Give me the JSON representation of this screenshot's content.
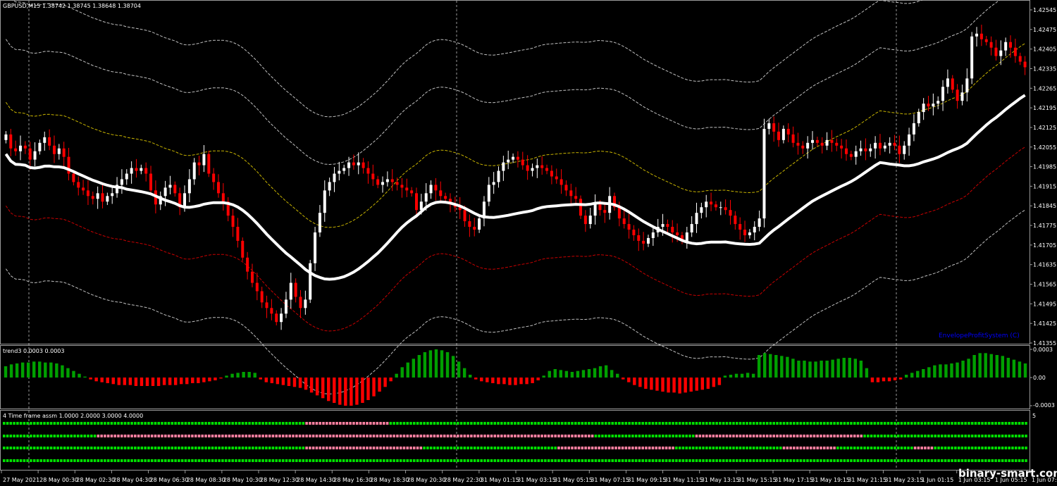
{
  "colors": {
    "background": "#000000",
    "bull_candle": "#ffffff",
    "bear_candle": "#ff0000",
    "ma_line": "#ffffff",
    "upper_env_1": "#c8b400",
    "lower_env_1": "#c80000",
    "outer_env": "#c0c0c0",
    "hist_up": "#00a000",
    "hist_down": "#ff0000",
    "dot_green": "#00e000",
    "dot_pink": "#ff7fa0",
    "signature": "#0000ff",
    "separator": "#9a9a9a",
    "grid_v": "#c0c0c0"
  },
  "main_header": {
    "symbol": "GBPUSD,M15",
    "ohlc": "1.38742 1.38745 1.38648 1.38704"
  },
  "main_signature": "EnvelopeProfitSystem (C)",
  "trend_header": "trend3 0.0003 0.0003",
  "tf_header": "4 Time frame assm 1.0000 2.0000 3.0000 4.0000",
  "tf_right_label": "5",
  "watermark": "binary-smart.com",
  "chart_data": [
    {
      "type": "candlestick",
      "title": "GBPUSD,M15",
      "y_ticks": [
        "1.42545",
        "1.42475",
        "1.42405",
        "1.42335",
        "1.42265",
        "1.42195",
        "1.42125",
        "1.42055",
        "1.41985",
        "1.41915",
        "1.41845",
        "1.41775",
        "1.41705",
        "1.41635",
        "1.41565",
        "1.41495",
        "1.41425",
        "1.41355"
      ],
      "ylim": [
        1.41355,
        1.42545
      ],
      "x_ticks": [
        "27 May 2021",
        "28 May 00:30",
        "28 May 02:30",
        "28 May 04:30",
        "28 May 06:30",
        "28 May 08:30",
        "28 May 10:30",
        "28 May 12:30",
        "28 May 14:30",
        "28 May 16:30",
        "28 May 18:30",
        "28 May 20:30",
        "28 May 22:30",
        "31 May 01:15",
        "31 May 03:15",
        "31 May 05:15",
        "31 May 07:15",
        "31 May 09:15",
        "31 May 11:15",
        "31 May 13:15",
        "31 May 15:15",
        "31 May 17:15",
        "31 May 19:15",
        "31 May 21:15",
        "31 May 23:15",
        "1 Jun 01:15",
        "1 Jun 03:15",
        "1 Jun 05:15",
        "1 Jun 07:15"
      ],
      "closes": [
        1.421,
        1.4205,
        1.4204,
        1.4206,
        1.4205,
        1.4201,
        1.4204,
        1.4207,
        1.4209,
        1.4206,
        1.4203,
        1.4205,
        1.4202,
        1.4196,
        1.4193,
        1.4191,
        1.419,
        1.4188,
        1.4187,
        1.4189,
        1.4186,
        1.4188,
        1.4189,
        1.4192,
        1.4194,
        1.4196,
        1.4198,
        1.4197,
        1.4198,
        1.4196,
        1.419,
        1.4185,
        1.4188,
        1.4191,
        1.4192,
        1.4189,
        1.4184,
        1.4189,
        1.4194,
        1.42,
        1.4199,
        1.4203,
        1.4196,
        1.4193,
        1.4189,
        1.4186,
        1.4181,
        1.4177,
        1.4172,
        1.4166,
        1.4161,
        1.4157,
        1.4154,
        1.415,
        1.4148,
        1.4146,
        1.4143,
        1.4146,
        1.4151,
        1.4157,
        1.4152,
        1.4148,
        1.4151,
        1.4164,
        1.4175,
        1.4182,
        1.419,
        1.4193,
        1.4196,
        1.4197,
        1.4198,
        1.42,
        1.4199,
        1.42,
        1.4198,
        1.4196,
        1.4194,
        1.4192,
        1.4193,
        1.4194,
        1.4193,
        1.4192,
        1.4191,
        1.419,
        1.4189,
        1.4183,
        1.4186,
        1.4189,
        1.4192,
        1.419,
        1.4188,
        1.4187,
        1.4185,
        1.4184,
        1.4183,
        1.4179,
        1.4177,
        1.4176,
        1.418,
        1.4186,
        1.4192,
        1.4193,
        1.4197,
        1.42,
        1.4201,
        1.4202,
        1.4201,
        1.4199,
        1.4197,
        1.4198,
        1.4199,
        1.4198,
        1.4197,
        1.4195,
        1.4194,
        1.4192,
        1.419,
        1.4188,
        1.4187,
        1.4181,
        1.4178,
        1.4181,
        1.4185,
        1.4183,
        1.4182,
        1.4188,
        1.4184,
        1.418,
        1.4178,
        1.4176,
        1.4174,
        1.4172,
        1.4171,
        1.4173,
        1.4175,
        1.4177,
        1.4178,
        1.4177,
        1.4175,
        1.4174,
        1.4172,
        1.4175,
        1.4178,
        1.4182,
        1.4184,
        1.4186,
        1.4185,
        1.4184,
        1.4184,
        1.4183,
        1.4181,
        1.4178,
        1.4176,
        1.4174,
        1.4175,
        1.4177,
        1.418,
        1.4212,
        1.4214,
        1.4211,
        1.4208,
        1.4212,
        1.421,
        1.4207,
        1.4206,
        1.4205,
        1.4207,
        1.4208,
        1.4207,
        1.4206,
        1.4208,
        1.4207,
        1.4206,
        1.4205,
        1.4203,
        1.4202,
        1.4204,
        1.4205,
        1.4204,
        1.4205,
        1.4207,
        1.4205,
        1.4206,
        1.4207,
        1.4206,
        1.4203,
        1.4206,
        1.421,
        1.4214,
        1.4218,
        1.4221,
        1.422,
        1.4221,
        1.4222,
        1.4227,
        1.423,
        1.4226,
        1.4222,
        1.4225,
        1.423,
        1.4245,
        1.4246,
        1.4244,
        1.4243,
        1.4241,
        1.4238,
        1.424,
        1.4243,
        1.4241,
        1.4238,
        1.4236,
        1.4234
      ],
      "series": [
        {
          "name": "MA",
          "color": "#ffffff"
        },
        {
          "name": "Envelope +1",
          "color": "#c8b400"
        },
        {
          "name": "Envelope -1",
          "color": "#c80000"
        },
        {
          "name": "Envelope +2",
          "color": "#c0c0c0"
        },
        {
          "name": "Envelope -2",
          "color": "#c0c0c0"
        }
      ]
    },
    {
      "type": "bar",
      "title": "trend3 0.0003 0.0003",
      "y_ticks": [
        "0.0003",
        "0.00",
        "-0.0003"
      ],
      "ylim": [
        -0.0003,
        0.0003
      ],
      "values": [
        0.00012,
        0.00014,
        0.00015,
        0.00016,
        0.00016,
        0.00017,
        0.00017,
        0.00016,
        0.00016,
        0.00015,
        0.00013,
        0.0001,
        7e-05,
        4e-05,
        1e-05,
        -2e-05,
        -4e-05,
        -5e-05,
        -6e-05,
        -7e-05,
        -8e-05,
        -8e-05,
        -8e-05,
        -9e-05,
        -9e-05,
        -9e-05,
        -9e-05,
        -9e-05,
        -8e-05,
        -8e-05,
        -8e-05,
        -7e-05,
        -7e-05,
        -6e-05,
        -6e-05,
        -5e-05,
        -4e-05,
        -3e-05,
        -1e-05,
        2e-05,
        4e-05,
        5e-05,
        6e-05,
        6e-05,
        5e-05,
        -2e-05,
        -5e-05,
        -6e-05,
        -7e-05,
        -8e-05,
        -9e-05,
        -0.0001,
        -0.00011,
        -0.00013,
        -0.00016,
        -0.00019,
        -0.00022,
        -0.00025,
        -0.00027,
        -0.00029,
        -0.0003,
        -0.0003,
        -0.00029,
        -0.00027,
        -0.00024,
        -0.0002,
        -0.00015,
        -0.0001,
        -4e-05,
        4e-05,
        0.00011,
        0.00016,
        0.0002,
        0.00024,
        0.00027,
        0.00029,
        0.0003,
        0.00029,
        0.00027,
        0.00023,
        0.00017,
        0.0001,
        3e-05,
        -2e-05,
        -4e-05,
        -5e-05,
        -6e-05,
        -7e-05,
        -7e-05,
        -8e-05,
        -8e-05,
        -7e-05,
        -7e-05,
        -6e-05,
        -3e-05,
        2e-05,
        7e-05,
        9e-05,
        8e-05,
        7e-05,
        6e-05,
        7e-05,
        8e-05,
        9e-05,
        0.0001,
        0.00012,
        0.00013,
        8e-05,
        4e-05,
        -2e-05,
        -5e-05,
        -8e-05,
        -0.0001,
        -0.00012,
        -0.00013,
        -0.00014,
        -0.00015,
        -0.00016,
        -0.00016,
        -0.00017,
        -0.00016,
        -0.00015,
        -0.00014,
        -0.00013,
        -0.00012,
        -0.0001,
        -8e-05,
        2e-05,
        3e-05,
        4e-05,
        4e-05,
        5e-05,
        4e-05,
        0.00024,
        0.00026,
        0.00025,
        0.00024,
        0.00023,
        0.00022,
        0.0002,
        0.00018,
        0.00018,
        0.00017,
        0.00017,
        0.00018,
        0.00018,
        0.00019,
        0.0002,
        0.00021,
        0.00021,
        0.0002,
        0.00018,
        0.0001,
        -5e-05,
        -5e-05,
        -4e-05,
        -4e-05,
        -3e-05,
        -2e-05,
        3e-05,
        5e-05,
        7e-05,
        9e-05,
        0.00011,
        0.00013,
        0.00014,
        0.00014,
        0.00015,
        0.00016,
        0.00018,
        0.0002,
        0.00024,
        0.00026,
        0.00026,
        0.00025,
        0.00024,
        0.00023,
        0.00021,
        0.00019,
        0.00017,
        0.00015
      ]
    },
    {
      "type": "heatmap",
      "title": "4 Time frame assm 1.0000 2.0000 3.0000 4.0000",
      "rows": [
        {
          "name": "1",
          "segments": [
            [
              "g",
              90
            ],
            [
              "p",
              25
            ],
            [
              "g",
              190
            ]
          ]
        },
        {
          "name": "2",
          "segments": [
            [
              "g",
              28
            ],
            [
              "p",
              148
            ],
            [
              "g",
              30
            ],
            [
              "p",
              50
            ],
            [
              "g",
              49
            ]
          ]
        },
        {
          "name": "3",
          "segments": [
            [
              "g",
              90
            ],
            [
              "p",
              35
            ],
            [
              "g",
              40
            ],
            [
              "p",
              35
            ],
            [
              "g",
              32
            ],
            [
              "p",
              16
            ],
            [
              "g",
              23
            ],
            [
              "p",
              6
            ],
            [
              "g",
              28
            ]
          ]
        },
        {
          "name": "4",
          "segments": [
            [
              "g",
              305
            ]
          ]
        }
      ]
    }
  ]
}
